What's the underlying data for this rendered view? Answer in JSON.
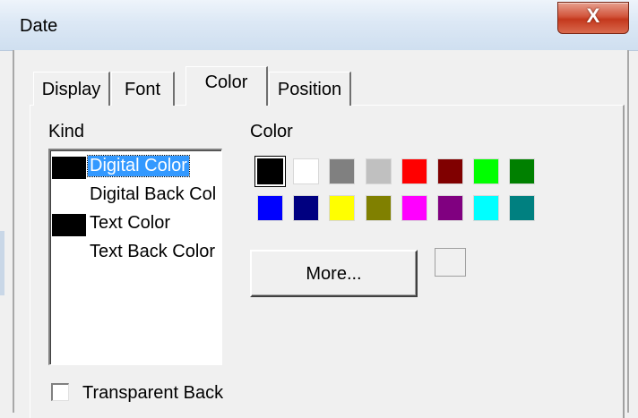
{
  "window": {
    "title": "Date",
    "close_label": "X"
  },
  "tabs": [
    {
      "label": "Display"
    },
    {
      "label": "Font"
    },
    {
      "label": "Color",
      "active": true
    },
    {
      "label": "Position"
    }
  ],
  "kind": {
    "label": "Kind",
    "items": [
      {
        "label": "Digital Color",
        "swatch": "#000000",
        "selected": true
      },
      {
        "label": "Digital Back Col",
        "swatch": "#ffffff"
      },
      {
        "label": "Text Color",
        "swatch": "#000000"
      },
      {
        "label": "Text Back Color",
        "swatch": "#ffffff"
      }
    ]
  },
  "color": {
    "label": "Color",
    "palette": [
      "#000000",
      "#ffffff",
      "#808080",
      "#c0c0c0",
      "#ff0000",
      "#800000",
      "#00ff00",
      "#008000",
      "#0000ff",
      "#000080",
      "#ffff00",
      "#808000",
      "#ff00ff",
      "#800080",
      "#00ffff",
      "#008080"
    ],
    "selected_index": 0,
    "more_label": "More...",
    "preview_color": "#f0f0f0"
  },
  "transparent_back": {
    "label": "Transparent Back",
    "checked": false
  }
}
